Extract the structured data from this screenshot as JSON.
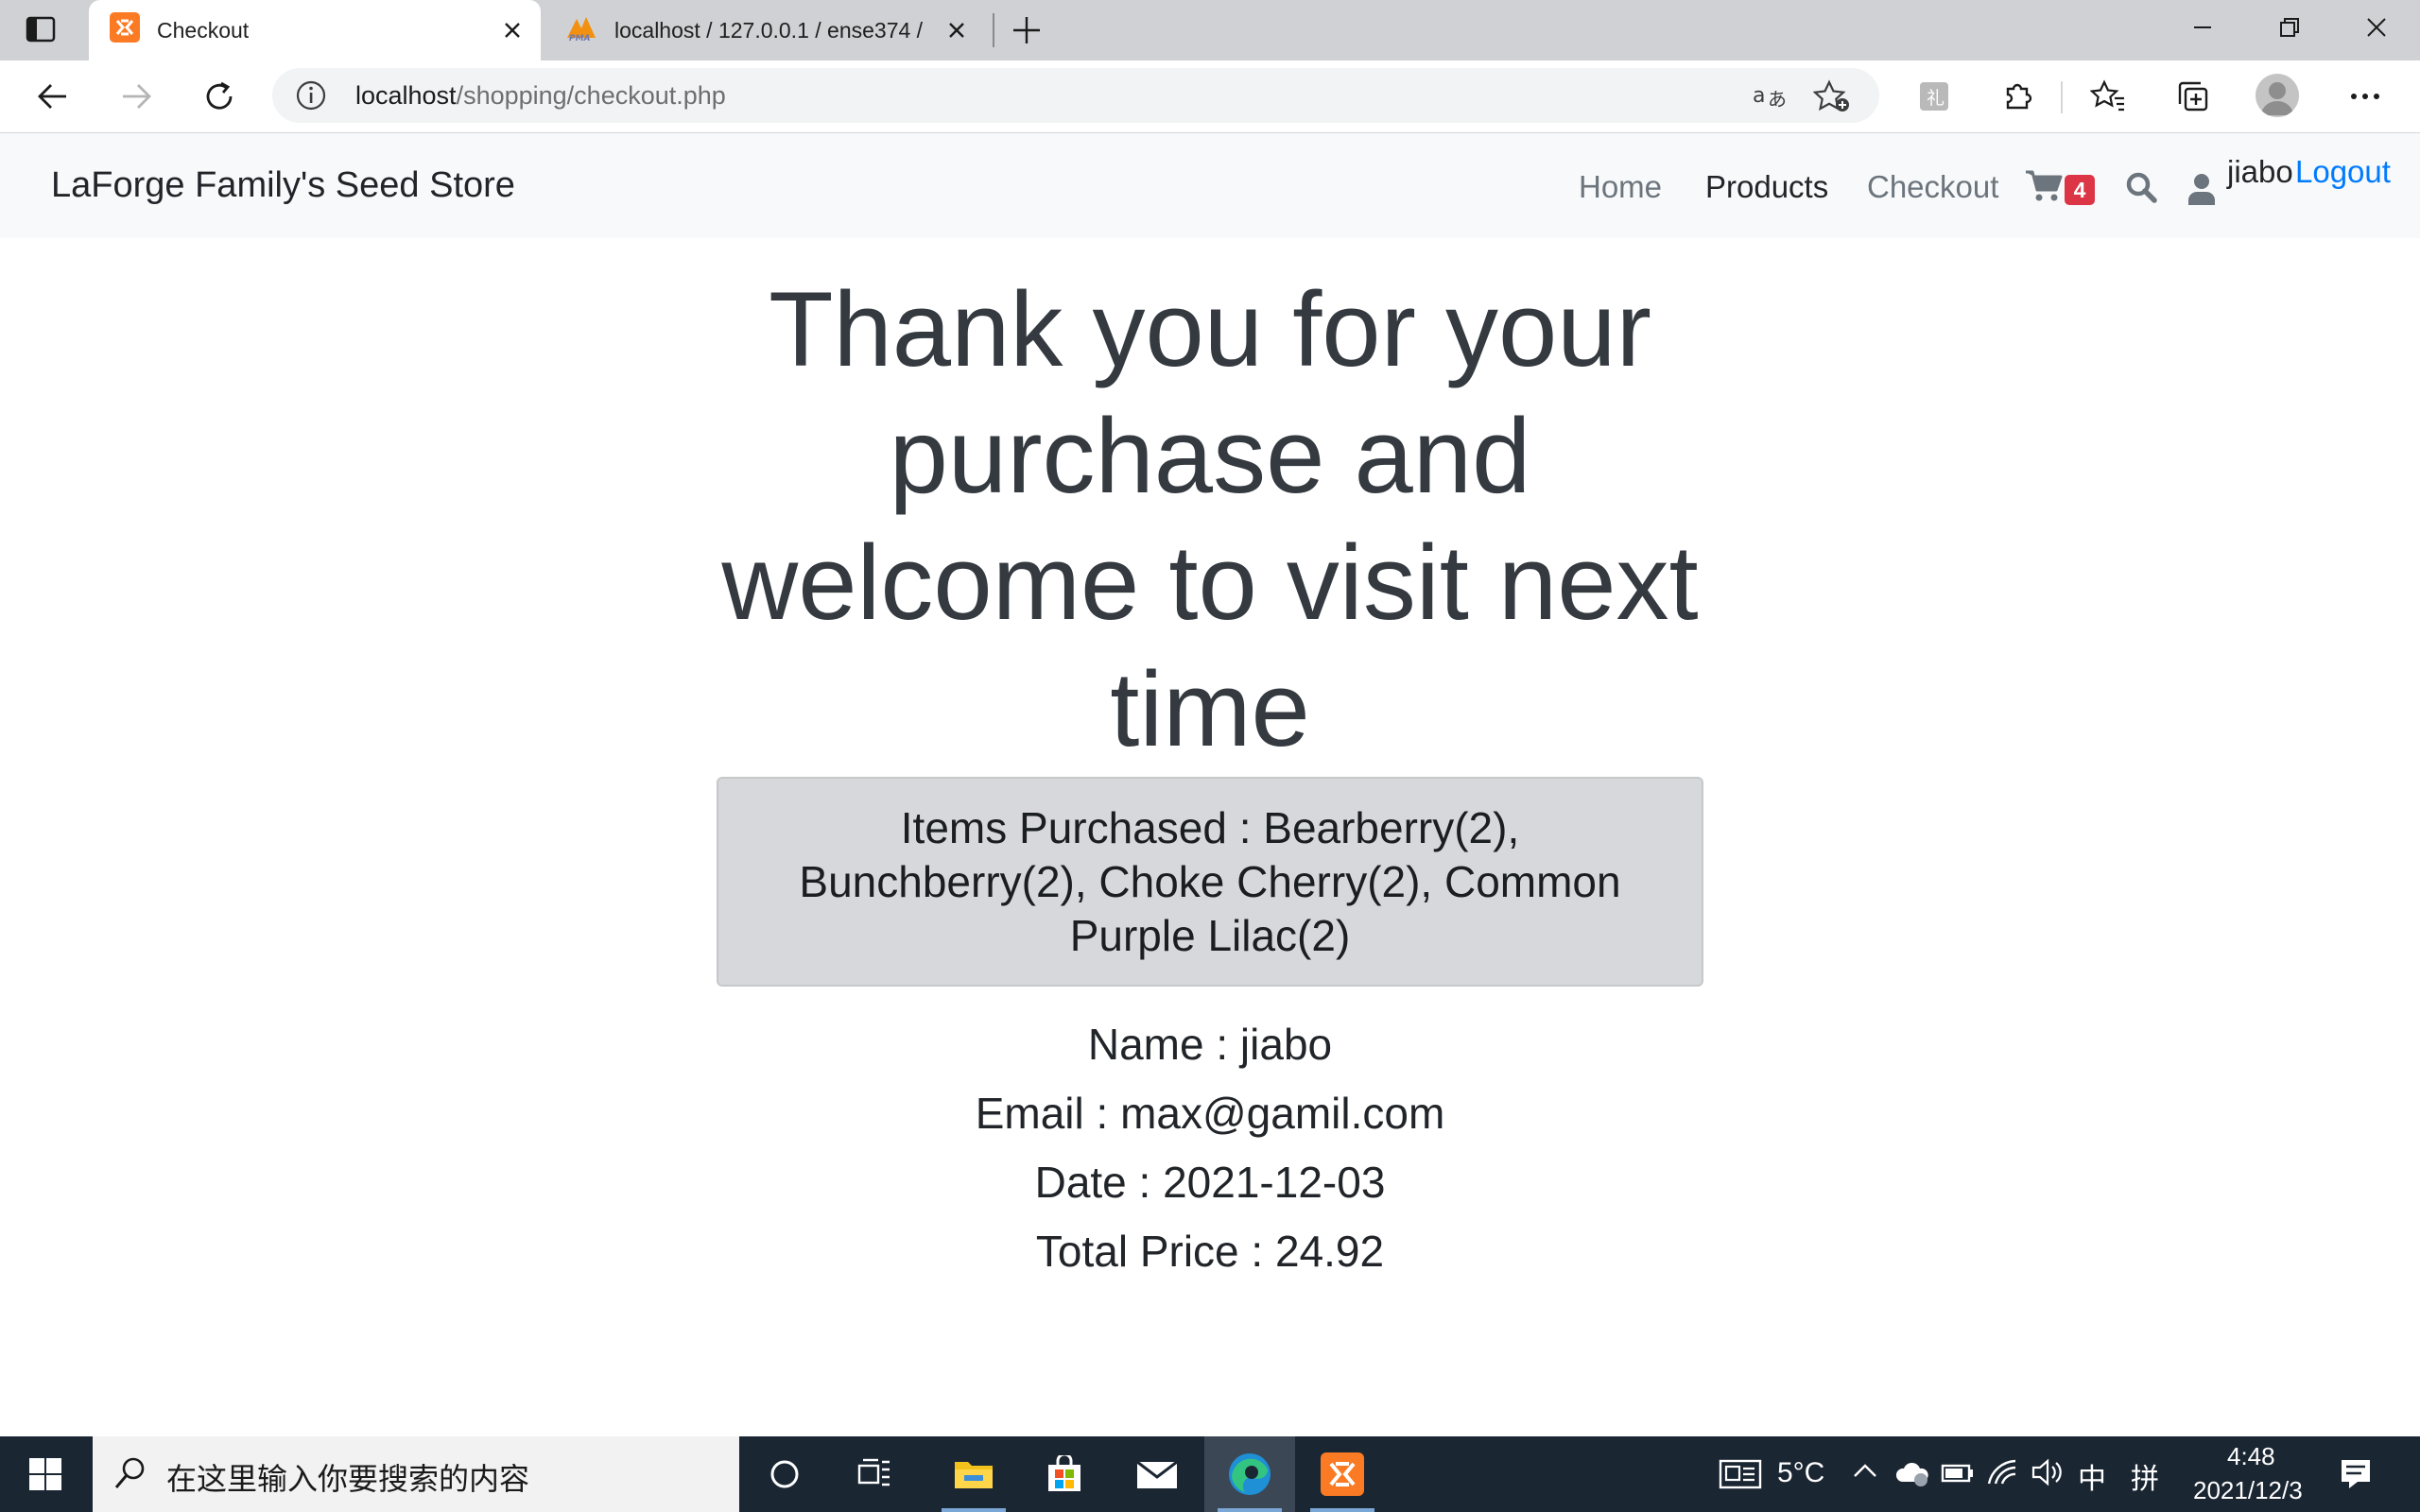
{
  "browser": {
    "tabs": [
      {
        "title": "Checkout",
        "active": true
      },
      {
        "title": "localhost / 127.0.0.1 / ense374 / ",
        "active": false
      }
    ],
    "url_host": "localhost",
    "url_path": "/shopping/checkout.php"
  },
  "navbar": {
    "brand": "LaForge Family's Seed Store",
    "links": [
      "Home",
      "Products",
      "Checkout"
    ],
    "cart_count": "4",
    "username": "jiabo",
    "logout": "Logout"
  },
  "page": {
    "heading_lines": [
      "Thank you for your",
      "purchase and",
      "welcome to visit next",
      "time"
    ],
    "items_purchased": "Items Purchased : Bearberry(2), Bunchberry(2), Choke Cherry(2), Common Purple Lilac(2)",
    "name": "Name : jiabo",
    "email": "Email : max@gamil.com",
    "date": "Date : 2021-12-03",
    "total": "Total Price : 24.92"
  },
  "taskbar": {
    "search_placeholder": "在这里输入你要搜索的内容",
    "weather": "5°C",
    "ime_lang": "中",
    "ime_mode": "拼",
    "time": "4:48",
    "date": "2021/12/3"
  },
  "colors": {
    "accent_link": "#007bff",
    "badge": "#dc3545",
    "items_box_bg": "#d6d8db"
  }
}
